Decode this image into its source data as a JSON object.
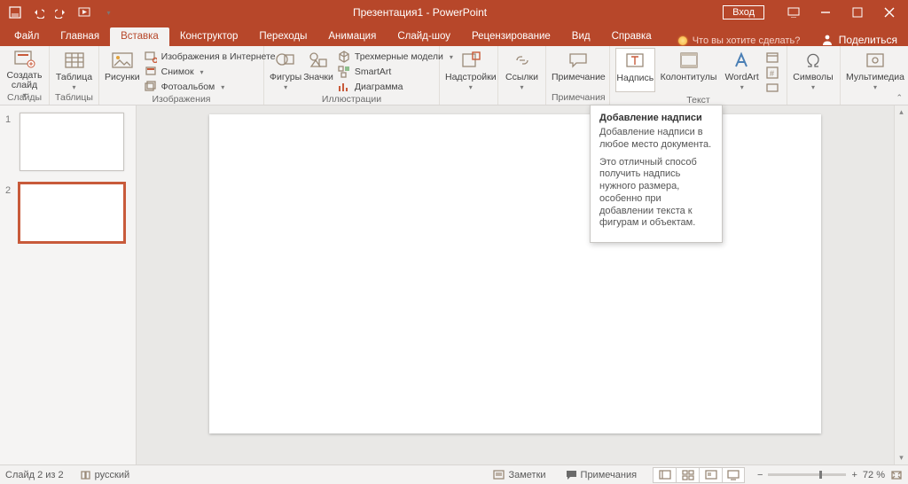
{
  "app": {
    "title": "Презентация1 - PowerPoint",
    "login": "Вход"
  },
  "tabs": {
    "file": "Файл",
    "home": "Главная",
    "insert": "Вставка",
    "design": "Конструктор",
    "transitions": "Переходы",
    "animations": "Анимация",
    "slideshow": "Слайд-шоу",
    "review": "Рецензирование",
    "view": "Вид",
    "help": "Справка",
    "tell": "Что вы хотите сделать?",
    "share": "Поделиться"
  },
  "ribbon": {
    "slides": {
      "label": "Слайды",
      "newslide": "Создать слайд"
    },
    "tables": {
      "label": "Таблицы",
      "table": "Таблица"
    },
    "images": {
      "label": "Изображения",
      "pictures": "Рисунки",
      "online": "Изображения в Интернете",
      "screenshot": "Снимок",
      "album": "Фотоальбом"
    },
    "illus": {
      "label": "Иллюстрации",
      "shapes": "Фигуры",
      "icons": "Значки",
      "models3d": "Трехмерные модели",
      "smartart": "SmartArt",
      "chart": "Диаграмма"
    },
    "addins": {
      "label": "",
      "btn": "Надстройки"
    },
    "links": {
      "label": "",
      "btn": "Ссылки"
    },
    "comments": {
      "label": "Примечания",
      "btn": "Примечание"
    },
    "text": {
      "label": "Текст",
      "textbox": "Надпись",
      "headerfooter": "Колонтитулы",
      "wordart": "WordArt"
    },
    "symbols": {
      "label": "",
      "btn": "Символы"
    },
    "media": {
      "label": "",
      "btn": "Мультимедиа"
    }
  },
  "tooltip": {
    "title": "Добавление надписи",
    "p1": "Добавление надписи в любое место документа.",
    "p2": "Это отличный способ получить надпись нужного размера, особенно при добавлении текста к фигурам и объектам."
  },
  "thumbs": {
    "n1": "1",
    "n2": "2"
  },
  "status": {
    "slide": "Слайд 2 из 2",
    "lang": "русский",
    "notes": "Заметки",
    "comments": "Примечания",
    "zoom": "72 %"
  }
}
